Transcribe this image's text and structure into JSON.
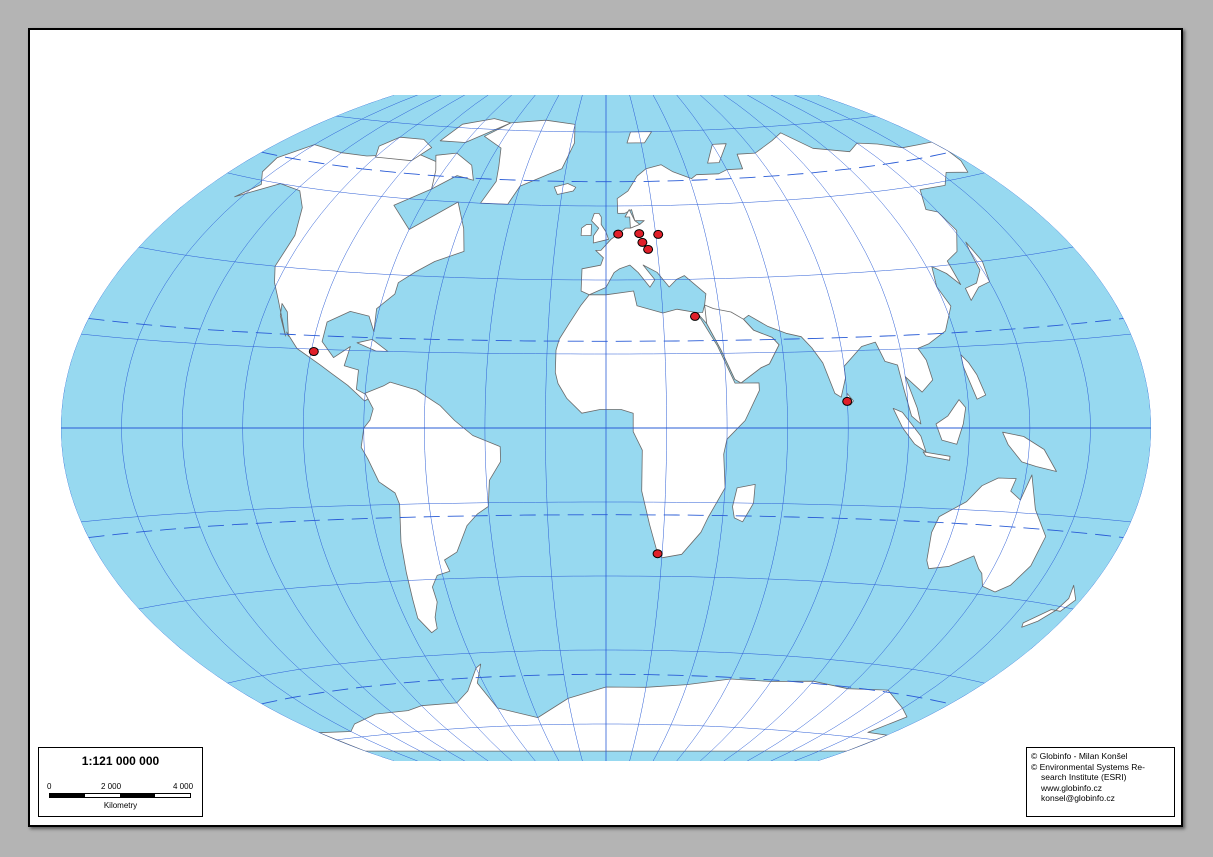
{
  "map": {
    "projection": "Winkel Tripel",
    "ocean_color": "#97d9f0",
    "land_color": "#ffffff",
    "graticule_color": "#2a5cd6",
    "marker_color": "#e0202a",
    "markers": [
      {
        "name": "Mexico City",
        "lon": -99.1,
        "lat": 19.4
      },
      {
        "name": "Amsterdam",
        "lon": 4.9,
        "lat": 52.4
      },
      {
        "name": "Berlin",
        "lon": 13.4,
        "lat": 52.5
      },
      {
        "name": "Warsaw",
        "lon": 21.0,
        "lat": 52.2
      },
      {
        "name": "Prague",
        "lon": 14.4,
        "lat": 50.1
      },
      {
        "name": "Vienna",
        "lon": 16.4,
        "lat": 48.2
      },
      {
        "name": "Cairo",
        "lon": 31.2,
        "lat": 30.0
      },
      {
        "name": "Colombo",
        "lon": 79.9,
        "lat": 6.9
      },
      {
        "name": "Cape Town",
        "lon": 18.4,
        "lat": -33.9
      }
    ]
  },
  "scale": {
    "ratio": "1:121 000 000",
    "ticks": [
      "0",
      "2 000",
      "4 000"
    ],
    "unit": "Kilometry"
  },
  "credits": {
    "line1": "© Globinfo - Milan Konšel",
    "line2": "© Environmental Systems Re-",
    "line3": "search Institute (ESRI)",
    "line4": "www.globinfo.cz",
    "line5": "konsel@globinfo.cz"
  }
}
